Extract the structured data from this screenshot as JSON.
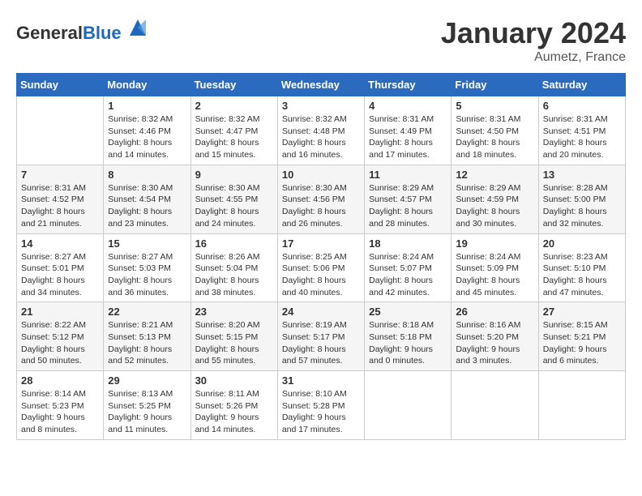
{
  "header": {
    "logo_general": "General",
    "logo_blue": "Blue",
    "month": "January 2024",
    "location": "Aumetz, France"
  },
  "days_of_week": [
    "Sunday",
    "Monday",
    "Tuesday",
    "Wednesday",
    "Thursday",
    "Friday",
    "Saturday"
  ],
  "weeks": [
    [
      {
        "day": "",
        "info": ""
      },
      {
        "day": "1",
        "info": "Sunrise: 8:32 AM\nSunset: 4:46 PM\nDaylight: 8 hours\nand 14 minutes."
      },
      {
        "day": "2",
        "info": "Sunrise: 8:32 AM\nSunset: 4:47 PM\nDaylight: 8 hours\nand 15 minutes."
      },
      {
        "day": "3",
        "info": "Sunrise: 8:32 AM\nSunset: 4:48 PM\nDaylight: 8 hours\nand 16 minutes."
      },
      {
        "day": "4",
        "info": "Sunrise: 8:31 AM\nSunset: 4:49 PM\nDaylight: 8 hours\nand 17 minutes."
      },
      {
        "day": "5",
        "info": "Sunrise: 8:31 AM\nSunset: 4:50 PM\nDaylight: 8 hours\nand 18 minutes."
      },
      {
        "day": "6",
        "info": "Sunrise: 8:31 AM\nSunset: 4:51 PM\nDaylight: 8 hours\nand 20 minutes."
      }
    ],
    [
      {
        "day": "7",
        "info": "Sunrise: 8:31 AM\nSunset: 4:52 PM\nDaylight: 8 hours\nand 21 minutes."
      },
      {
        "day": "8",
        "info": "Sunrise: 8:30 AM\nSunset: 4:54 PM\nDaylight: 8 hours\nand 23 minutes."
      },
      {
        "day": "9",
        "info": "Sunrise: 8:30 AM\nSunset: 4:55 PM\nDaylight: 8 hours\nand 24 minutes."
      },
      {
        "day": "10",
        "info": "Sunrise: 8:30 AM\nSunset: 4:56 PM\nDaylight: 8 hours\nand 26 minutes."
      },
      {
        "day": "11",
        "info": "Sunrise: 8:29 AM\nSunset: 4:57 PM\nDaylight: 8 hours\nand 28 minutes."
      },
      {
        "day": "12",
        "info": "Sunrise: 8:29 AM\nSunset: 4:59 PM\nDaylight: 8 hours\nand 30 minutes."
      },
      {
        "day": "13",
        "info": "Sunrise: 8:28 AM\nSunset: 5:00 PM\nDaylight: 8 hours\nand 32 minutes."
      }
    ],
    [
      {
        "day": "14",
        "info": "Sunrise: 8:27 AM\nSunset: 5:01 PM\nDaylight: 8 hours\nand 34 minutes."
      },
      {
        "day": "15",
        "info": "Sunrise: 8:27 AM\nSunset: 5:03 PM\nDaylight: 8 hours\nand 36 minutes."
      },
      {
        "day": "16",
        "info": "Sunrise: 8:26 AM\nSunset: 5:04 PM\nDaylight: 8 hours\nand 38 minutes."
      },
      {
        "day": "17",
        "info": "Sunrise: 8:25 AM\nSunset: 5:06 PM\nDaylight: 8 hours\nand 40 minutes."
      },
      {
        "day": "18",
        "info": "Sunrise: 8:24 AM\nSunset: 5:07 PM\nDaylight: 8 hours\nand 42 minutes."
      },
      {
        "day": "19",
        "info": "Sunrise: 8:24 AM\nSunset: 5:09 PM\nDaylight: 8 hours\nand 45 minutes."
      },
      {
        "day": "20",
        "info": "Sunrise: 8:23 AM\nSunset: 5:10 PM\nDaylight: 8 hours\nand 47 minutes."
      }
    ],
    [
      {
        "day": "21",
        "info": "Sunrise: 8:22 AM\nSunset: 5:12 PM\nDaylight: 8 hours\nand 50 minutes."
      },
      {
        "day": "22",
        "info": "Sunrise: 8:21 AM\nSunset: 5:13 PM\nDaylight: 8 hours\nand 52 minutes."
      },
      {
        "day": "23",
        "info": "Sunrise: 8:20 AM\nSunset: 5:15 PM\nDaylight: 8 hours\nand 55 minutes."
      },
      {
        "day": "24",
        "info": "Sunrise: 8:19 AM\nSunset: 5:17 PM\nDaylight: 8 hours\nand 57 minutes."
      },
      {
        "day": "25",
        "info": "Sunrise: 8:18 AM\nSunset: 5:18 PM\nDaylight: 9 hours\nand 0 minutes."
      },
      {
        "day": "26",
        "info": "Sunrise: 8:16 AM\nSunset: 5:20 PM\nDaylight: 9 hours\nand 3 minutes."
      },
      {
        "day": "27",
        "info": "Sunrise: 8:15 AM\nSunset: 5:21 PM\nDaylight: 9 hours\nand 6 minutes."
      }
    ],
    [
      {
        "day": "28",
        "info": "Sunrise: 8:14 AM\nSunset: 5:23 PM\nDaylight: 9 hours\nand 8 minutes."
      },
      {
        "day": "29",
        "info": "Sunrise: 8:13 AM\nSunset: 5:25 PM\nDaylight: 9 hours\nand 11 minutes."
      },
      {
        "day": "30",
        "info": "Sunrise: 8:11 AM\nSunset: 5:26 PM\nDaylight: 9 hours\nand 14 minutes."
      },
      {
        "day": "31",
        "info": "Sunrise: 8:10 AM\nSunset: 5:28 PM\nDaylight: 9 hours\nand 17 minutes."
      },
      {
        "day": "",
        "info": ""
      },
      {
        "day": "",
        "info": ""
      },
      {
        "day": "",
        "info": ""
      }
    ]
  ]
}
